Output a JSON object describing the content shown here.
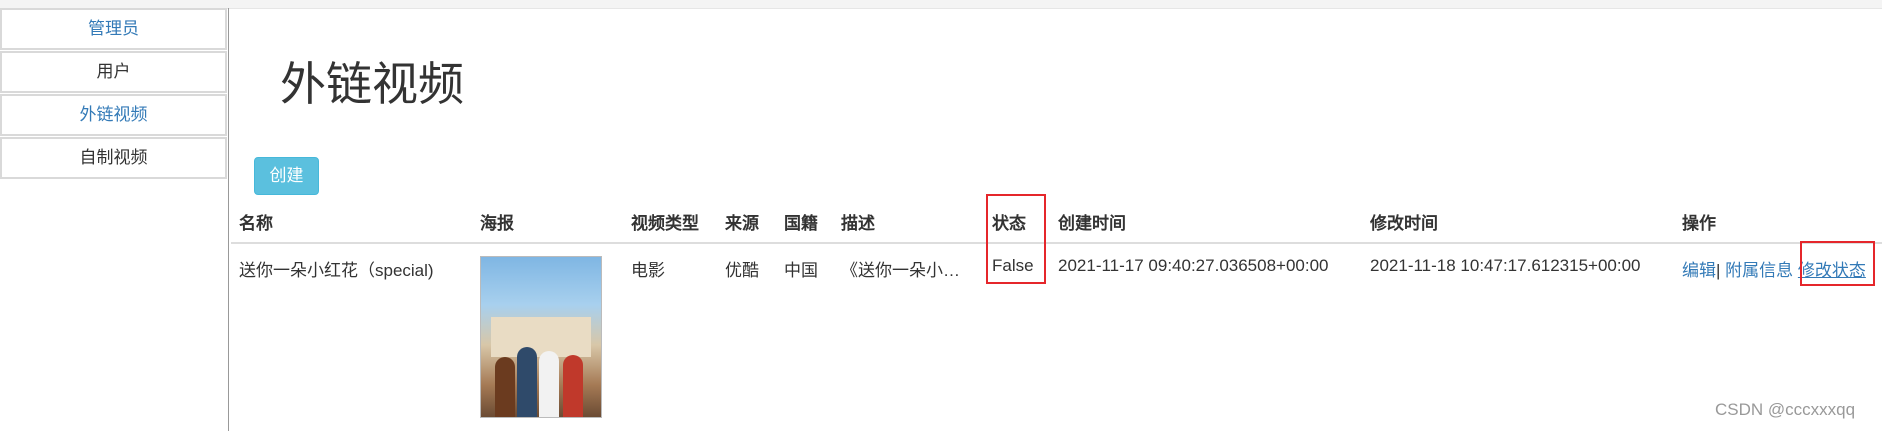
{
  "sidebar": {
    "items": [
      {
        "label": "管理员"
      },
      {
        "label": "用户"
      },
      {
        "label": "外链视频"
      },
      {
        "label": "自制视频"
      }
    ]
  },
  "page": {
    "title": "外链视频",
    "create_label": "创建"
  },
  "table": {
    "headers": [
      "名称",
      "海报",
      "视频类型",
      "来源",
      "国籍",
      "描述",
      "状态",
      "创建时间",
      "修改时间",
      "操作"
    ],
    "rows": [
      {
        "name": "送你一朵小红花（special)",
        "poster_alt": "poster-image",
        "type": "电影",
        "source": "优酷",
        "country": "中国",
        "description": "《送你一朵小…",
        "status": "False",
        "created": "2021-11-17 09:40:27.036508+00:00",
        "modified": "2021-11-18 10:47:17.612315+00:00",
        "op_edit": "编辑",
        "op_sep": "|",
        "op_attach": "附属信息",
        "op_status": "修改状态"
      }
    ]
  },
  "watermark": "CSDN @cccxxxqq",
  "colors": {
    "link": "#337ab7",
    "button": "#5bc0de",
    "highlight": "#e5262b"
  }
}
